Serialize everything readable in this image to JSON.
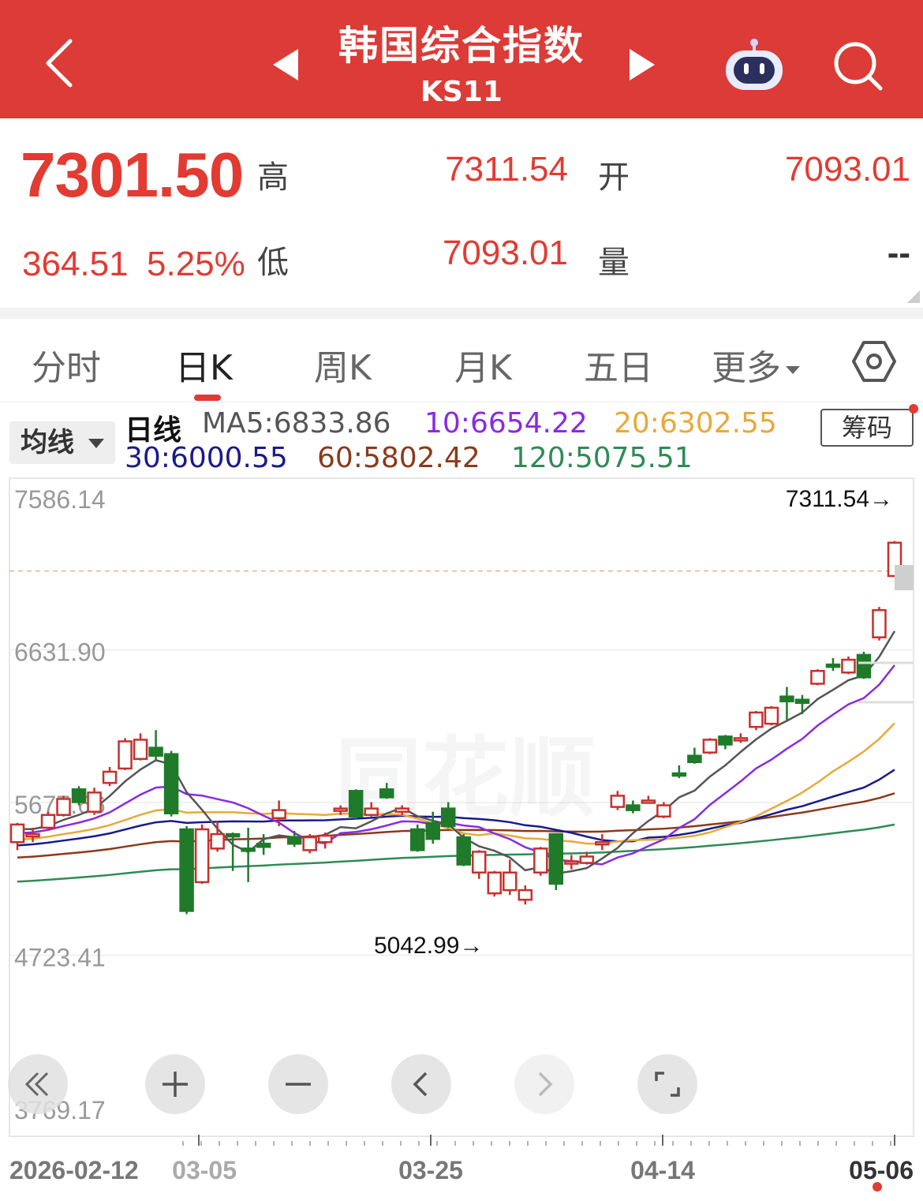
{
  "header": {
    "title": "韩国综合指数",
    "code": "KS11",
    "bg_color": "#dc3b37"
  },
  "quote": {
    "price": "7301.50",
    "change": "364.51",
    "change_pct": "5.25%",
    "high_label": "高",
    "high": "7311.54",
    "open_label": "开",
    "open": "7093.01",
    "low_label": "低",
    "low": "7093.01",
    "volume_label": "量",
    "volume": "--",
    "up_color": "#e23b32"
  },
  "tabs": [
    {
      "label": "分时"
    },
    {
      "label": "日K"
    },
    {
      "label": "周K"
    },
    {
      "label": "月K"
    },
    {
      "label": "五日"
    },
    {
      "label": "更多"
    }
  ],
  "legend": {
    "selector": "均线",
    "period": "日线",
    "ma5": "MA5:6833.86",
    "ma10": "10:6654.22",
    "ma20": "20:6302.55",
    "ma30": "30:6000.55",
    "ma60": "60:5802.42",
    "ma120": "120:5075.51",
    "chips_button": "筹码",
    "colors": {
      "ma5": "#555555",
      "ma10": "#8a2be2",
      "ma20": "#e8a93a",
      "ma30": "#1a1a8c",
      "ma60": "#8b3a1a",
      "ma120": "#2e8b57"
    }
  },
  "chart_data": {
    "type": "candlestick",
    "y_ticks": [
      "7586.14",
      "6631.90",
      "5677.66",
      "4723.41",
      "3769.17"
    ],
    "ylim": [
      3769.17,
      7586.14
    ],
    "x_ticks": [
      "2026-02-12",
      "03-05",
      "03-25",
      "04-14",
      "05-06"
    ],
    "high_marker": "7311.54→",
    "low_marker": "5042.99→",
    "reference_line": 7311.54,
    "candles": [
      [
        5430,
        5540,
        5550,
        5380
      ],
      [
        5470,
        5480,
        5520,
        5430
      ],
      [
        5520,
        5600,
        5620,
        5510
      ],
      [
        5600,
        5700,
        5720,
        5590
      ],
      [
        5760,
        5680,
        5780,
        5660
      ],
      [
        5620,
        5740,
        5770,
        5600
      ],
      [
        5800,
        5870,
        5900,
        5780
      ],
      [
        5890,
        6060,
        6080,
        5880
      ],
      [
        5950,
        6070,
        6110,
        5940
      ],
      [
        6020,
        5970,
        6130,
        5940
      ],
      [
        5980,
        5610,
        6000,
        5590
      ],
      [
        5510,
        5000,
        5530,
        4980
      ],
      [
        5180,
        5510,
        5540,
        5170
      ],
      [
        5390,
        5480,
        5560,
        5370
      ],
      [
        5480,
        5470,
        5490,
        5250
      ],
      [
        5390,
        5380,
        5520,
        5180
      ],
      [
        5420,
        5400,
        5480,
        5350
      ],
      [
        5580,
        5630,
        5690,
        5530
      ],
      [
        5460,
        5420,
        5500,
        5400
      ],
      [
        5380,
        5460,
        5480,
        5360
      ],
      [
        5430,
        5470,
        5490,
        5390
      ],
      [
        5630,
        5640,
        5660,
        5600
      ],
      [
        5750,
        5590,
        5760,
        5570
      ],
      [
        5600,
        5640,
        5680,
        5590
      ],
      [
        5760,
        5710,
        5800,
        5700
      ],
      [
        5620,
        5640,
        5660,
        5600
      ],
      [
        5510,
        5380,
        5540,
        5370
      ],
      [
        5550,
        5450,
        5620,
        5420
      ],
      [
        5640,
        5530,
        5680,
        5520
      ],
      [
        5460,
        5290,
        5480,
        5280
      ],
      [
        5240,
        5370,
        5380,
        5200
      ],
      [
        5110,
        5240,
        5250,
        5090
      ],
      [
        5130,
        5240,
        5320,
        5100
      ],
      [
        5070,
        5130,
        5160,
        5040
      ],
      [
        5240,
        5390,
        5400,
        5220
      ],
      [
        5480,
        5170,
        5480,
        5130
      ],
      [
        5300,
        5310,
        5350,
        5260
      ],
      [
        5300,
        5340,
        5370,
        5290
      ],
      [
        5420,
        5430,
        5480,
        5380
      ],
      [
        5650,
        5720,
        5750,
        5630
      ],
      [
        5660,
        5630,
        5690,
        5610
      ],
      [
        5690,
        5690,
        5720,
        5670
      ],
      [
        5590,
        5660,
        5680,
        5580
      ],
      [
        5860,
        5850,
        5910,
        5830
      ],
      [
        5970,
        5930,
        6020,
        5920
      ],
      [
        5990,
        6070,
        6080,
        5980
      ],
      [
        6090,
        6040,
        6100,
        6010
      ],
      [
        6080,
        6080,
        6110,
        6050
      ],
      [
        6150,
        6240,
        6250,
        6130
      ],
      [
        6170,
        6270,
        6280,
        6160
      ],
      [
        6340,
        6310,
        6400,
        6190
      ],
      [
        6320,
        6300,
        6350,
        6230
      ],
      [
        6420,
        6500,
        6510,
        6410
      ],
      [
        6540,
        6530,
        6580,
        6500
      ],
      [
        6490,
        6570,
        6590,
        6480
      ],
      [
        6600,
        6460,
        6620,
        6450
      ],
      [
        6710,
        6880,
        6900,
        6690
      ],
      [
        7093.01,
        7301.5,
        7311.54,
        7093.01
      ]
    ]
  }
}
